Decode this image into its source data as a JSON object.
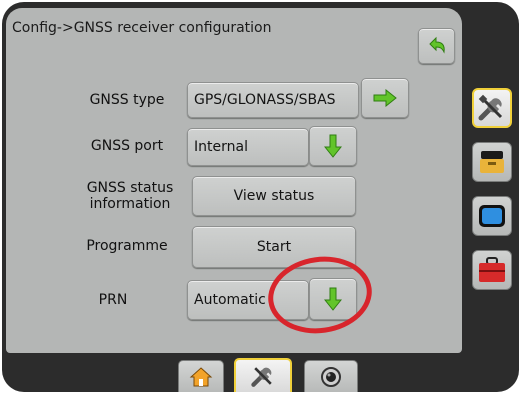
{
  "header": {
    "title": "Config->GNSS receiver configuration",
    "back_icon": "back-arrow-icon"
  },
  "rows": [
    {
      "label": "GNSS type",
      "value": "GPS/GLONASS/SBAS",
      "icon": "arrow-right-icon"
    },
    {
      "label": "GNSS port",
      "value": "Internal",
      "icon": "arrow-down-icon"
    },
    {
      "label": "GNSS status information",
      "value": "View status"
    },
    {
      "label": "Programme",
      "value": "Start"
    },
    {
      "label": "PRN",
      "value": "Automatic",
      "icon": "arrow-down-icon"
    }
  ],
  "right_rail": {
    "tabs": [
      {
        "icon": "tools-icon",
        "active": true
      },
      {
        "icon": "console-icon",
        "active": false
      },
      {
        "icon": "screen-icon",
        "active": false
      },
      {
        "icon": "toolbox-icon",
        "active": false
      }
    ]
  },
  "bottom_bar": {
    "tabs": [
      {
        "icon": "home-icon",
        "active": false
      },
      {
        "icon": "tools-icon",
        "active": true
      },
      {
        "icon": "camera-icon",
        "active": false
      }
    ]
  },
  "colors": {
    "panel_bg": "#b4b6b5",
    "frame": "#2c2c2c",
    "arrow_green": "#62c42a",
    "active_outline": "#f0d03a",
    "highlight": "#d8252c"
  }
}
